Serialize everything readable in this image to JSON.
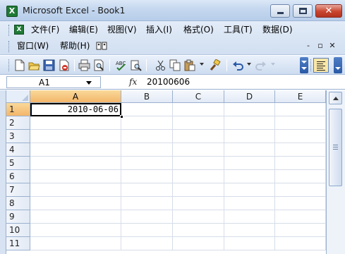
{
  "window": {
    "title": "Microsoft Excel - Book1",
    "app_icon_glyph": "X",
    "close_glyph": "✕"
  },
  "menu": {
    "row1": [
      {
        "label": "文件(F)"
      },
      {
        "label": "编辑(E)"
      },
      {
        "label": "视图(V)"
      },
      {
        "label": "插入(I)"
      },
      {
        "label": "格式(O)"
      },
      {
        "label": "工具(T)"
      },
      {
        "label": "数据(D)"
      }
    ],
    "row2": [
      {
        "label": "窗口(W)"
      },
      {
        "label": "帮助(H)"
      }
    ],
    "mdi_minimize": "-",
    "mdi_restore": "▫",
    "mdi_close": "✕"
  },
  "toolbar": {
    "icons": [
      "new-icon",
      "open-icon",
      "save-icon",
      "permission-icon",
      "print-icon",
      "print-preview-icon",
      "spelling-icon",
      "research-icon",
      "cut-icon",
      "copy-icon",
      "paste-icon",
      "format-painter-icon",
      "undo-icon",
      "redo-icon"
    ]
  },
  "formula_bar": {
    "name_box": "A1",
    "fx_label": "fx",
    "content": "20100606"
  },
  "grid": {
    "columns": [
      "A",
      "B",
      "C",
      "D",
      "E"
    ],
    "active_column": "A",
    "rows": [
      "1",
      "2",
      "3",
      "4",
      "5",
      "6",
      "7",
      "8",
      "9",
      "10",
      "11"
    ],
    "active_row": "1",
    "cells": {
      "A1": "2010-06-06"
    }
  },
  "colors": {
    "accent_header": "#f3b66a",
    "chrome": "#d1dff1",
    "grid_line": "#d6dde8"
  }
}
